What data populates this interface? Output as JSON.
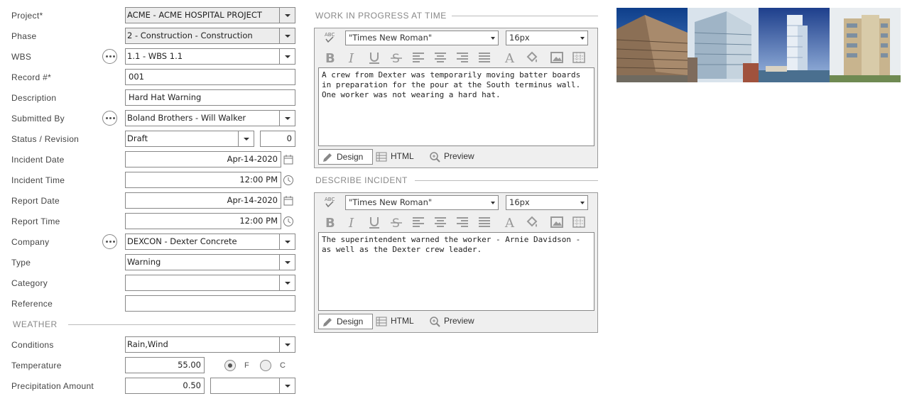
{
  "form": {
    "project": {
      "label": "Project*",
      "value": "ACME - ACME HOSPITAL PROJECT"
    },
    "phase": {
      "label": "Phase",
      "value": "2 - Construction - Construction"
    },
    "wbs": {
      "label": "WBS",
      "value": "1.1 - WBS 1.1"
    },
    "record": {
      "label": "Record #*",
      "value": "001"
    },
    "description": {
      "label": "Description",
      "value": "Hard Hat Warning"
    },
    "submitted_by": {
      "label": "Submitted By",
      "value": "Boland Brothers - Will Walker"
    },
    "status": {
      "label": "Status / Revision",
      "value": "Draft",
      "revision": "0"
    },
    "incident_date": {
      "label": "Incident Date",
      "value": "Apr-14-2020"
    },
    "incident_time": {
      "label": "Incident Time",
      "value": "12:00 PM"
    },
    "report_date": {
      "label": "Report Date",
      "value": "Apr-14-2020"
    },
    "report_time": {
      "label": "Report Time",
      "value": "12:00 PM"
    },
    "company": {
      "label": "Company",
      "value": "DEXCON - Dexter Concrete"
    },
    "type": {
      "label": "Type",
      "value": "Warning"
    },
    "category": {
      "label": "Category",
      "value": ""
    },
    "reference": {
      "label": "Reference",
      "value": ""
    }
  },
  "weather": {
    "title": "WEATHER",
    "conditions": {
      "label": "Conditions",
      "value": "Rain,Wind"
    },
    "temperature": {
      "label": "Temperature",
      "value": "55.00",
      "unit_f": "F",
      "unit_c": "C",
      "selected": "F"
    },
    "precipitation": {
      "label": "Precipitation Amount",
      "value": "0.50",
      "unit": ""
    }
  },
  "editors": [
    {
      "title": "WORK IN PROGRESS AT TIME",
      "font": "\"Times New Roman\"",
      "size": "16px",
      "text": "A crew from Dexter was temporarily moving batter boards in preparation for the pour at the South terminus wall. One worker was not wearing a hard hat.",
      "modes": {
        "design": "Design",
        "html": "HTML",
        "preview": "Preview"
      }
    },
    {
      "title": "DESCRIBE INCIDENT",
      "font": "\"Times New Roman\"",
      "size": "16px",
      "text": "The superintendent warned the worker - Arnie Davidson - as well as the Dexter crew leader.",
      "modes": {
        "design": "Design",
        "html": "HTML",
        "preview": "Preview"
      }
    }
  ],
  "icons": [
    "ellipsis-icon",
    "calendar-icon",
    "clock-icon",
    "spellcheck-icon",
    "bold-icon",
    "italic-icon",
    "underline-icon",
    "strikethrough-icon",
    "align-left-icon",
    "align-center-icon",
    "align-right-icon",
    "justify-icon",
    "font-color-icon",
    "fill-color-icon",
    "image-icon",
    "table-icon",
    "pencil-icon",
    "grid-icon",
    "zoom-icon"
  ]
}
